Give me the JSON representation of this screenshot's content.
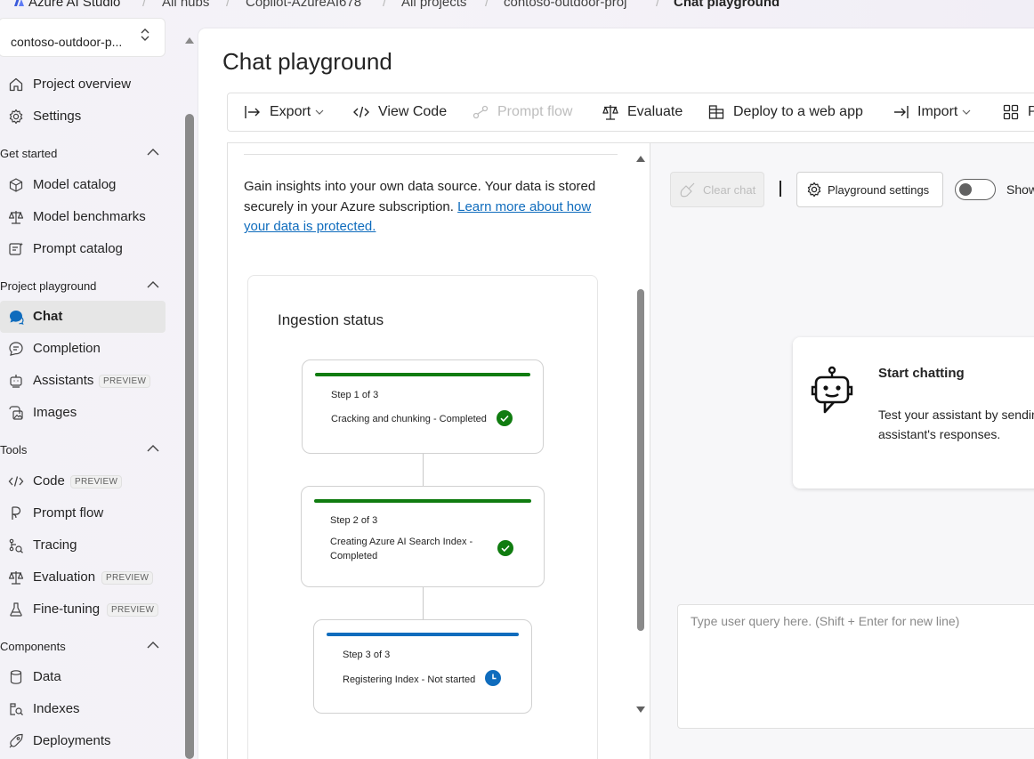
{
  "breadcrumb": {
    "brand": "Azure AI Studio",
    "items": [
      "All hubs",
      "Copilot-AzureAI678",
      "All projects",
      "contoso-outdoor-proj",
      "Chat playground"
    ]
  },
  "sidebar": {
    "project_name": "contoso-outdoor-p...",
    "top_items": [
      {
        "label": "Project overview",
        "icon": "home-icon"
      },
      {
        "label": "Settings",
        "icon": "gear-icon"
      }
    ],
    "sections": [
      {
        "title": "Get started",
        "items": [
          {
            "label": "Model catalog",
            "icon": "cube-icon"
          },
          {
            "label": "Model benchmarks",
            "icon": "scales-icon"
          },
          {
            "label": "Prompt catalog",
            "icon": "prompt-icon"
          }
        ]
      },
      {
        "title": "Project playground",
        "items": [
          {
            "label": "Chat",
            "icon": "chat-icon"
          },
          {
            "label": "Completion",
            "icon": "completion-icon"
          },
          {
            "label": "Assistants",
            "icon": "bot-icon",
            "badge": "PREVIEW"
          },
          {
            "label": "Images",
            "icon": "image-icon"
          }
        ]
      },
      {
        "title": "Tools",
        "items": [
          {
            "label": "Code",
            "icon": "code-icon",
            "badge": "PREVIEW"
          },
          {
            "label": "Prompt flow",
            "icon": "flow-icon"
          },
          {
            "label": "Tracing",
            "icon": "tracing-icon"
          },
          {
            "label": "Evaluation",
            "icon": "scales-icon",
            "badge": "PREVIEW"
          },
          {
            "label": "Fine-tuning",
            "icon": "flask-icon",
            "badge": "PREVIEW"
          }
        ]
      },
      {
        "title": "Components",
        "items": [
          {
            "label": "Data",
            "icon": "database-icon"
          },
          {
            "label": "Indexes",
            "icon": "index-icon"
          },
          {
            "label": "Deployments",
            "icon": "deploy-icon"
          }
        ]
      }
    ]
  },
  "page": {
    "title": "Chat playground"
  },
  "toolbar": {
    "export": "Export",
    "view_code": "View Code",
    "prompt_flow": "Prompt flow",
    "evaluate": "Evaluate",
    "deploy": "Deploy to a web app",
    "import": "Import",
    "more": "P"
  },
  "data_panel": {
    "info_text": "Gain insights into your own data source. Your data is stored securely in your Azure subscription.",
    "link_text": "Learn more about how your data is protected."
  },
  "ingestion": {
    "title": "Ingestion status",
    "steps": [
      {
        "step": "Step 1 of 3",
        "desc": "Cracking and chunking - Completed",
        "status": "completed",
        "color": "#107c10"
      },
      {
        "step": "Step 2 of 3",
        "desc": "Creating Azure AI Search Index - Completed",
        "status": "completed",
        "color": "#107c10"
      },
      {
        "step": "Step 3 of 3",
        "desc": "Registering Index - Not started",
        "status": "not-started",
        "color": "#0f6cbd"
      }
    ]
  },
  "chat": {
    "clear_chat": "Clear chat",
    "playground_settings": "Playground settings",
    "toggle_label": "Show",
    "start_title": "Start chatting",
    "start_text_1": "Test your assistant by sending queries below. Then adjust your",
    "start_text_2": "assistant's responses.",
    "query_placeholder": "Type user query here. (Shift + Enter for new line)"
  }
}
